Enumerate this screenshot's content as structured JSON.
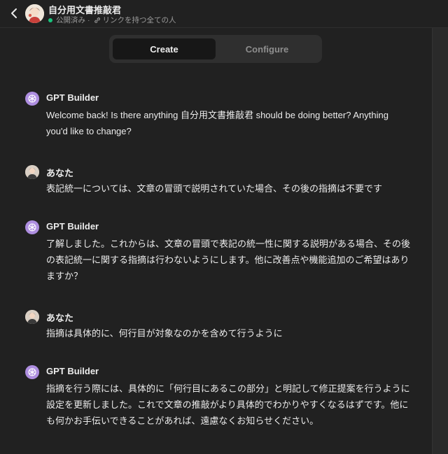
{
  "header": {
    "title": "自分用文書推敲君",
    "status": "公開済み",
    "separator": "·",
    "visibility": "リンクを持つ全ての人"
  },
  "tabs": {
    "create": "Create",
    "configure": "Configure",
    "active": "create"
  },
  "messages": [
    {
      "role": "builder",
      "name": "GPT Builder",
      "text": "Welcome back! Is there anything 自分用文書推敲君 should be doing better? Anything you'd like to change?"
    },
    {
      "role": "user",
      "name": "あなた",
      "text": "表記統一については、文章の冒頭で説明されていた場合、その後の指摘は不要です"
    },
    {
      "role": "builder",
      "name": "GPT Builder",
      "text": "了解しました。これからは、文章の冒頭で表記の統一性に関する説明がある場合、その後の表記統一に関する指摘は行わないようにします。他に改善点や機能追加のご希望はありますか？"
    },
    {
      "role": "user",
      "name": "あなた",
      "text": "指摘は具体的に、何行目が対象なのかを含めて行うように"
    },
    {
      "role": "builder",
      "name": "GPT Builder",
      "text": "指摘を行う際には、具体的に「何行目にあるこの部分」と明記して修正提案を行うように設定を更新しました。これで文章の推敲がより具体的でわかりやすくなるはずです。他にも何かお手伝いできることがあれば、遠慮なくお知らせください。"
    }
  ],
  "colors": {
    "background": "#212121",
    "builder_icon": "#ae8ee0",
    "status_green": "#19c37d"
  }
}
